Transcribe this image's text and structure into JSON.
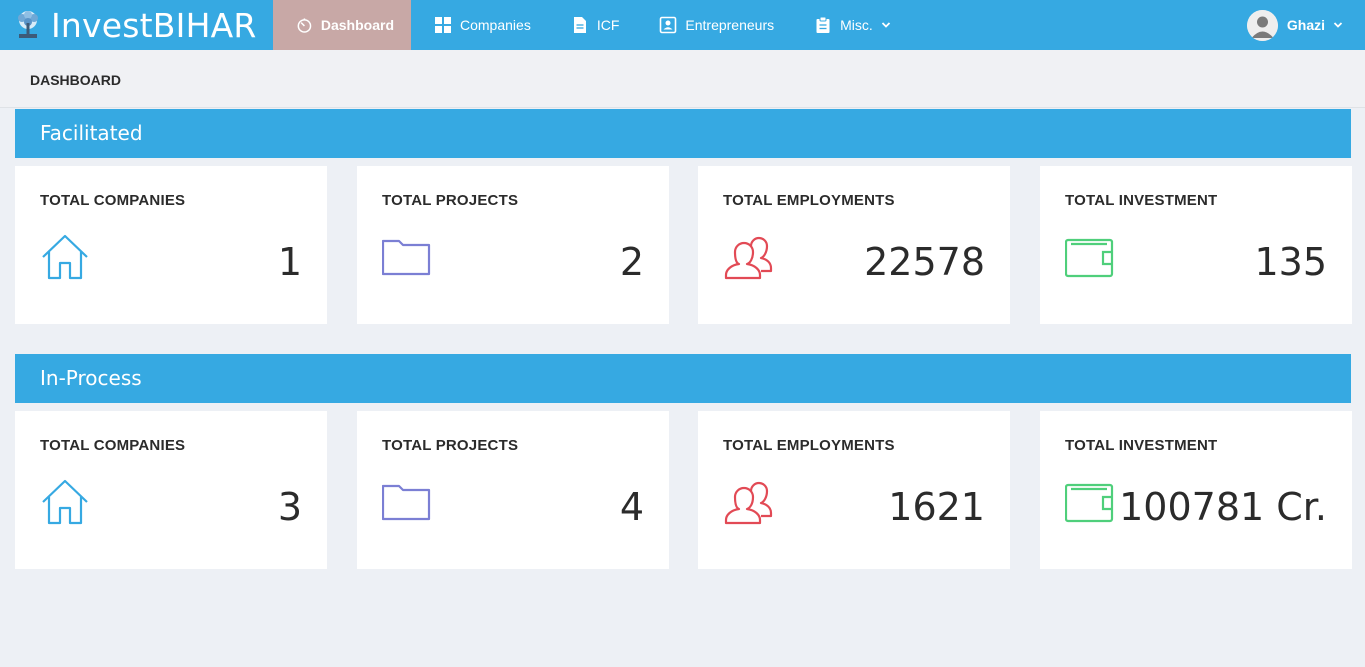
{
  "brand": {
    "name": "InvestBIHAR"
  },
  "nav": {
    "items": [
      {
        "label": "Dashboard",
        "icon": "dashboard-icon",
        "active": true
      },
      {
        "label": "Companies",
        "icon": "grid-icon"
      },
      {
        "label": "ICF",
        "icon": "document-icon"
      },
      {
        "label": "Entrepreneurs",
        "icon": "contact-card-icon"
      },
      {
        "label": "Misc.",
        "icon": "clipboard-icon",
        "dropdown": true
      }
    ]
  },
  "user": {
    "name": "Ghazi"
  },
  "breadcrumb": {
    "title": "DASHBOARD"
  },
  "sections": [
    {
      "title": "Facilitated",
      "cards": [
        {
          "label": "TOTAL COMPANIES",
          "value": "1",
          "icon": "home-icon",
          "color": "#36a9e2"
        },
        {
          "label": "TOTAL PROJECTS",
          "value": "2",
          "icon": "folder-icon",
          "color": "#7b7fd4"
        },
        {
          "label": "TOTAL EMPLOYMENTS",
          "value": "22578",
          "icon": "users-icon",
          "color": "#e24a55"
        },
        {
          "label": "TOTAL INVESTMENT",
          "value": "135",
          "icon": "wallet-icon",
          "color": "#4fcf7b"
        }
      ]
    },
    {
      "title": "In-Process",
      "cards": [
        {
          "label": "TOTAL COMPANIES",
          "value": "3",
          "icon": "home-icon",
          "color": "#36a9e2"
        },
        {
          "label": "TOTAL PROJECTS",
          "value": "4",
          "icon": "folder-icon",
          "color": "#7b7fd4"
        },
        {
          "label": "TOTAL EMPLOYMENTS",
          "value": "1621",
          "icon": "users-icon",
          "color": "#e24a55"
        },
        {
          "label": "TOTAL INVESTMENT",
          "value": "100781 Cr.",
          "icon": "wallet-icon",
          "color": "#4fcf7b"
        }
      ]
    }
  ]
}
